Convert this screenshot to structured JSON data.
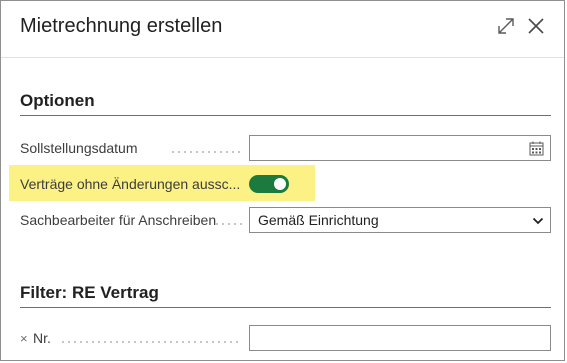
{
  "dialog": {
    "title": "Mietrechnung erstellen",
    "expand_icon": "expand-icon",
    "close_icon": "close-icon"
  },
  "options": {
    "title": "Optionen",
    "fields": {
      "sollstellungsdatum": {
        "label": "Sollstellungsdatum",
        "value": "",
        "icon": "calendar-icon"
      },
      "vertraege_ohne_aenderungen": {
        "label": "Verträge ohne Änderungen aussc...",
        "on": true
      },
      "sachbearbeiter": {
        "label": "Sachbearbeiter für Anschreiben",
        "selected": "Gemäß Einrichtung"
      }
    }
  },
  "filter": {
    "title": "Filter: RE Vertrag",
    "fields": {
      "nr": {
        "remove_glyph": "×",
        "label": "Nr.",
        "value": ""
      }
    }
  },
  "colors": {
    "toggle_on": "#1d7a3e",
    "highlight": "#fbf184",
    "rule": "#6f6f6f"
  }
}
